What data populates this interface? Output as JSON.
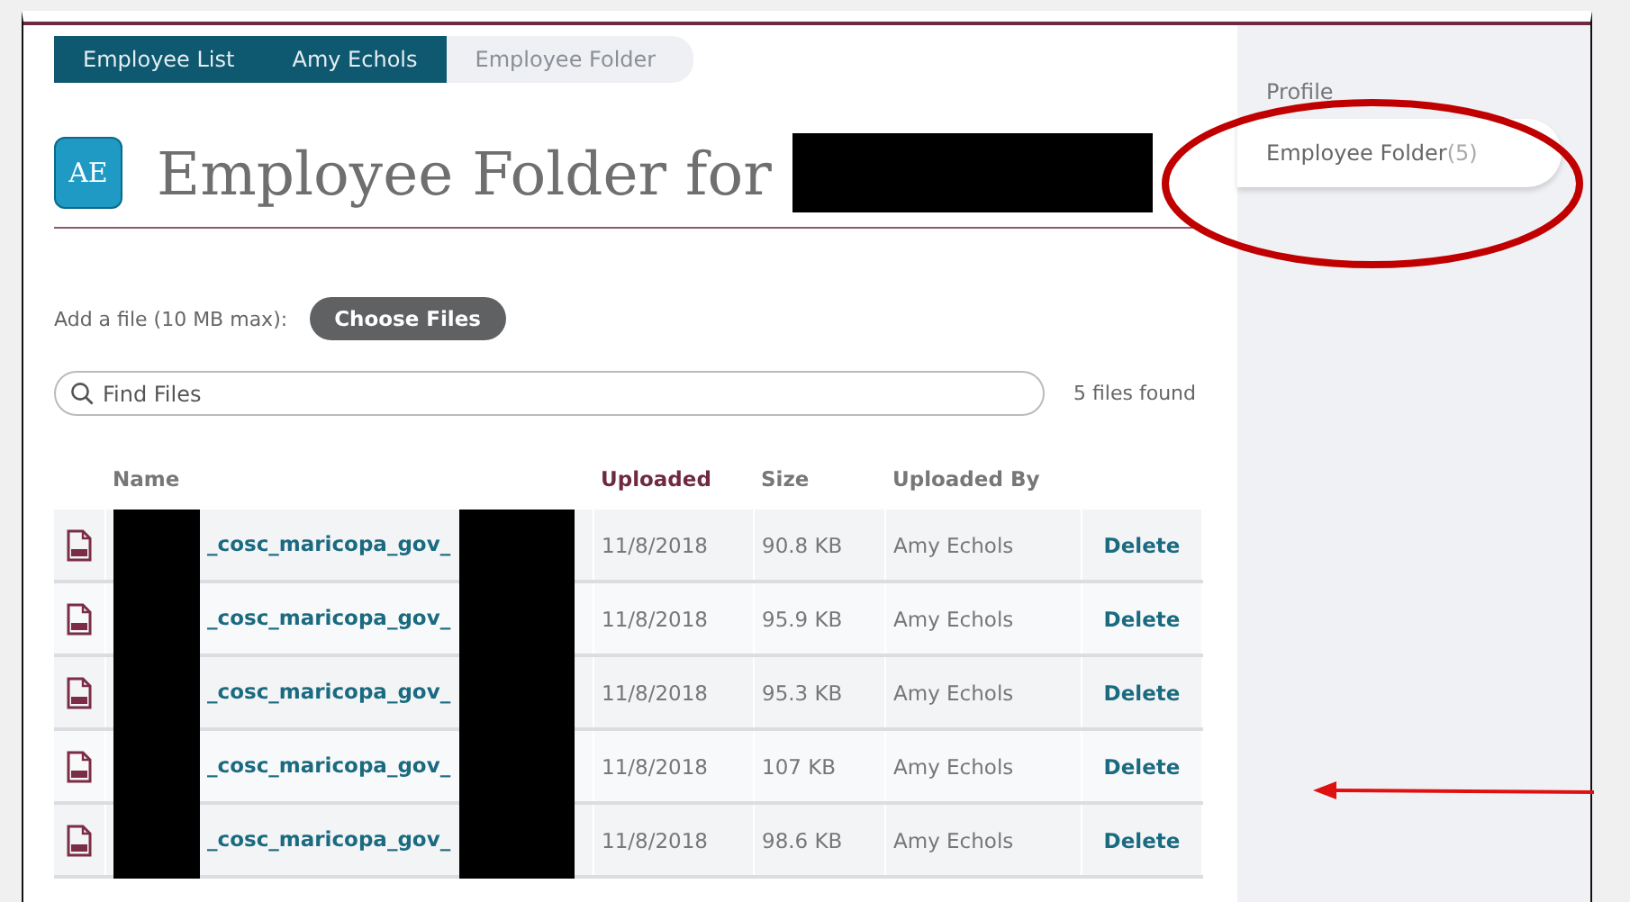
{
  "breadcrumbs": [
    {
      "label": "Employee List",
      "selected": false
    },
    {
      "label": "Amy Echols",
      "selected": false
    },
    {
      "label": "Employee Folder",
      "selected": true
    }
  ],
  "header": {
    "initials": "AE",
    "title": "Employee Folder for"
  },
  "upload": {
    "label": "Add a file (10 MB max):",
    "button": "Choose Files"
  },
  "search": {
    "placeholder": "Find Files",
    "result_count": "5 files found"
  },
  "table": {
    "columns": [
      {
        "label": "Name",
        "sorted": false
      },
      {
        "label": "Uploaded",
        "sorted": true
      },
      {
        "label": "Size",
        "sorted": false
      },
      {
        "label": "Uploaded By",
        "sorted": false
      }
    ],
    "rows": [
      {
        "name": "_cosc_maricopa_gov_",
        "uploaded": "11/8/2018",
        "size": "90.8 KB",
        "uploaded_by": "Amy Echols",
        "action": "Delete"
      },
      {
        "name": "_cosc_maricopa_gov_",
        "uploaded": "11/8/2018",
        "size": "95.9 KB",
        "uploaded_by": "Amy Echols",
        "action": "Delete"
      },
      {
        "name": "_cosc_maricopa_gov_",
        "uploaded": "11/8/2018",
        "size": "95.3 KB",
        "uploaded_by": "Amy Echols",
        "action": "Delete"
      },
      {
        "name": "_cosc_maricopa_gov_",
        "uploaded": "11/8/2018",
        "size": "107 KB",
        "uploaded_by": "Amy Echols",
        "action": "Delete"
      },
      {
        "name": "_cosc_maricopa_gov_",
        "uploaded": "11/8/2018",
        "size": "98.6 KB",
        "uploaded_by": "Amy Echols",
        "action": "Delete"
      }
    ]
  },
  "sidebar": {
    "items": [
      {
        "label": "Profile",
        "selected": false
      },
      {
        "label": "Employee Folder",
        "count": "(5)",
        "selected": true
      }
    ]
  }
}
